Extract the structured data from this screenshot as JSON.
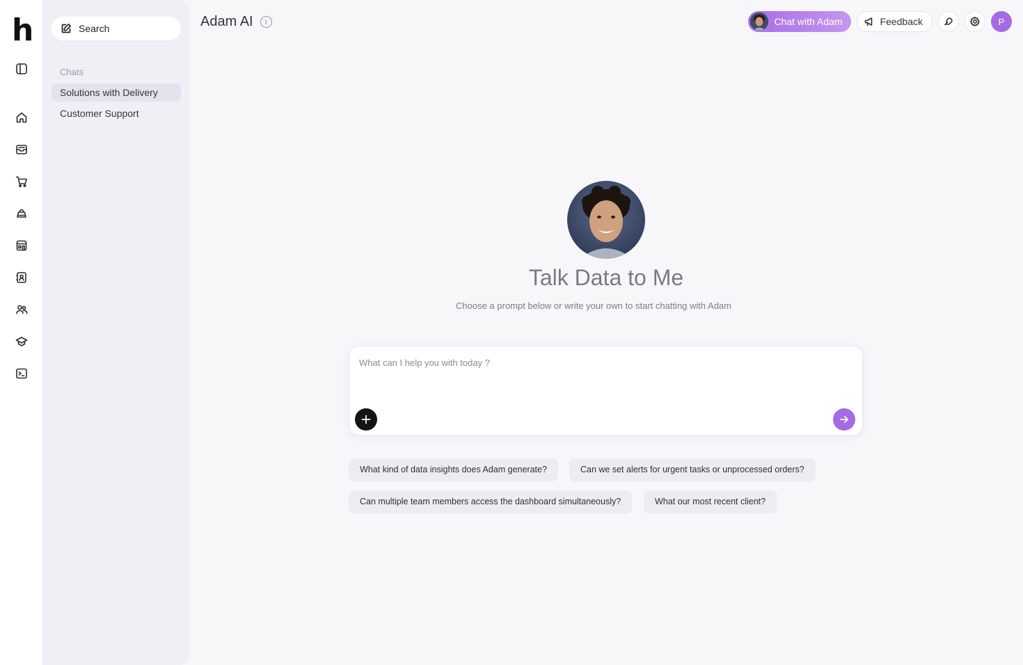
{
  "app": {
    "logo_letter": "h"
  },
  "rail": {
    "icons": [
      "sidebar-toggle-icon",
      "home-icon",
      "inbox-icon",
      "cart-icon",
      "bag-icon",
      "store-icon",
      "contacts-icon",
      "users-icon",
      "academy-icon",
      "terminal-icon"
    ]
  },
  "sidebar": {
    "search_label": "Search",
    "section_label": "Chats",
    "chats": [
      {
        "label": "Solutions with Delivery",
        "active": true
      },
      {
        "label": "Customer Support",
        "active": false
      }
    ]
  },
  "header": {
    "title": "Adam AI",
    "info_glyph": "i",
    "chat_with_label": "Chat with Adam",
    "feedback_label": "Feedback",
    "user_initial": "P"
  },
  "hero": {
    "title": "Talk Data to Me",
    "subtitle": "Choose a prompt below or write your own to start chatting with Adam"
  },
  "composer": {
    "placeholder": "What can I help you with today ?",
    "value": ""
  },
  "suggestions": [
    "What kind of data insights does Adam generate?",
    "Can we set alerts for urgent tasks or unprocessed orders?",
    "Can multiple team members access the dashboard simultaneously?",
    "What our most recent client?"
  ],
  "colors": {
    "accent": "#a56be3",
    "sidebar_bg": "#eff0f5",
    "page_bg": "#f7f7fa"
  }
}
